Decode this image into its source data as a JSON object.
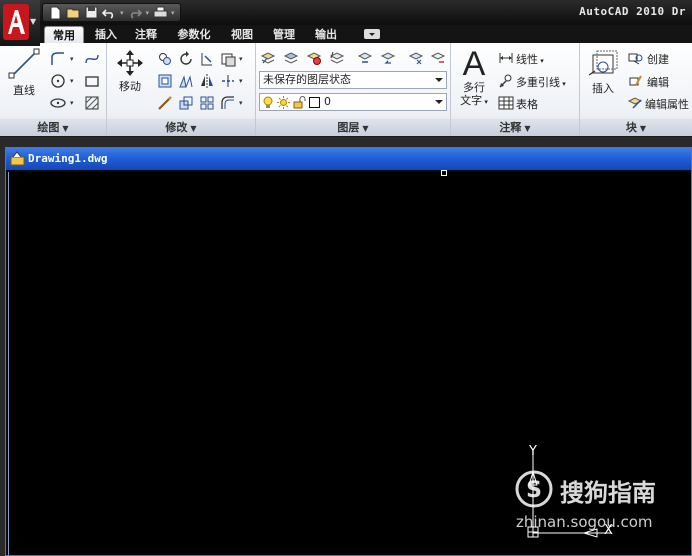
{
  "window": {
    "title": "AutoCAD 2010  Dr"
  },
  "quick_access": {
    "buttons": [
      "new-icon",
      "open-icon",
      "save-icon",
      "undo-icon",
      "redo-icon",
      "plot-icon",
      "customize-icon"
    ]
  },
  "tabs": [
    {
      "label": "常用",
      "active": true
    },
    {
      "label": "插入"
    },
    {
      "label": "注释"
    },
    {
      "label": "参数化"
    },
    {
      "label": "视图"
    },
    {
      "label": "管理"
    },
    {
      "label": "输出"
    }
  ],
  "ribbon": {
    "draw": {
      "title": "绘图",
      "line_label": "直线"
    },
    "modify": {
      "title": "修改",
      "move_label": "移动"
    },
    "layers": {
      "title": "图层",
      "state_value": "未保存的图层状态",
      "layer_value": "0"
    },
    "annotation": {
      "title": "注释",
      "mtext_label_1": "多行",
      "mtext_label_2": "文字",
      "linear_label": "线性",
      "multileader_label": "多重引线",
      "table_label": "表格"
    },
    "block": {
      "title": "块",
      "insert_label": "插入",
      "create_label": "创建",
      "edit_label": "编辑",
      "edit_attr_label": "编辑属性"
    }
  },
  "drawing": {
    "tab_title": "Drawing1.dwg",
    "ucs_y": "Y",
    "ucs_x": "X"
  },
  "watermark": {
    "brand": "搜狗指南",
    "url": "zhinan.sogou.com"
  },
  "colors": {
    "app_red": "#c8161d",
    "drawing_title_blue": "#1c5ad3",
    "canvas": "#000000"
  }
}
